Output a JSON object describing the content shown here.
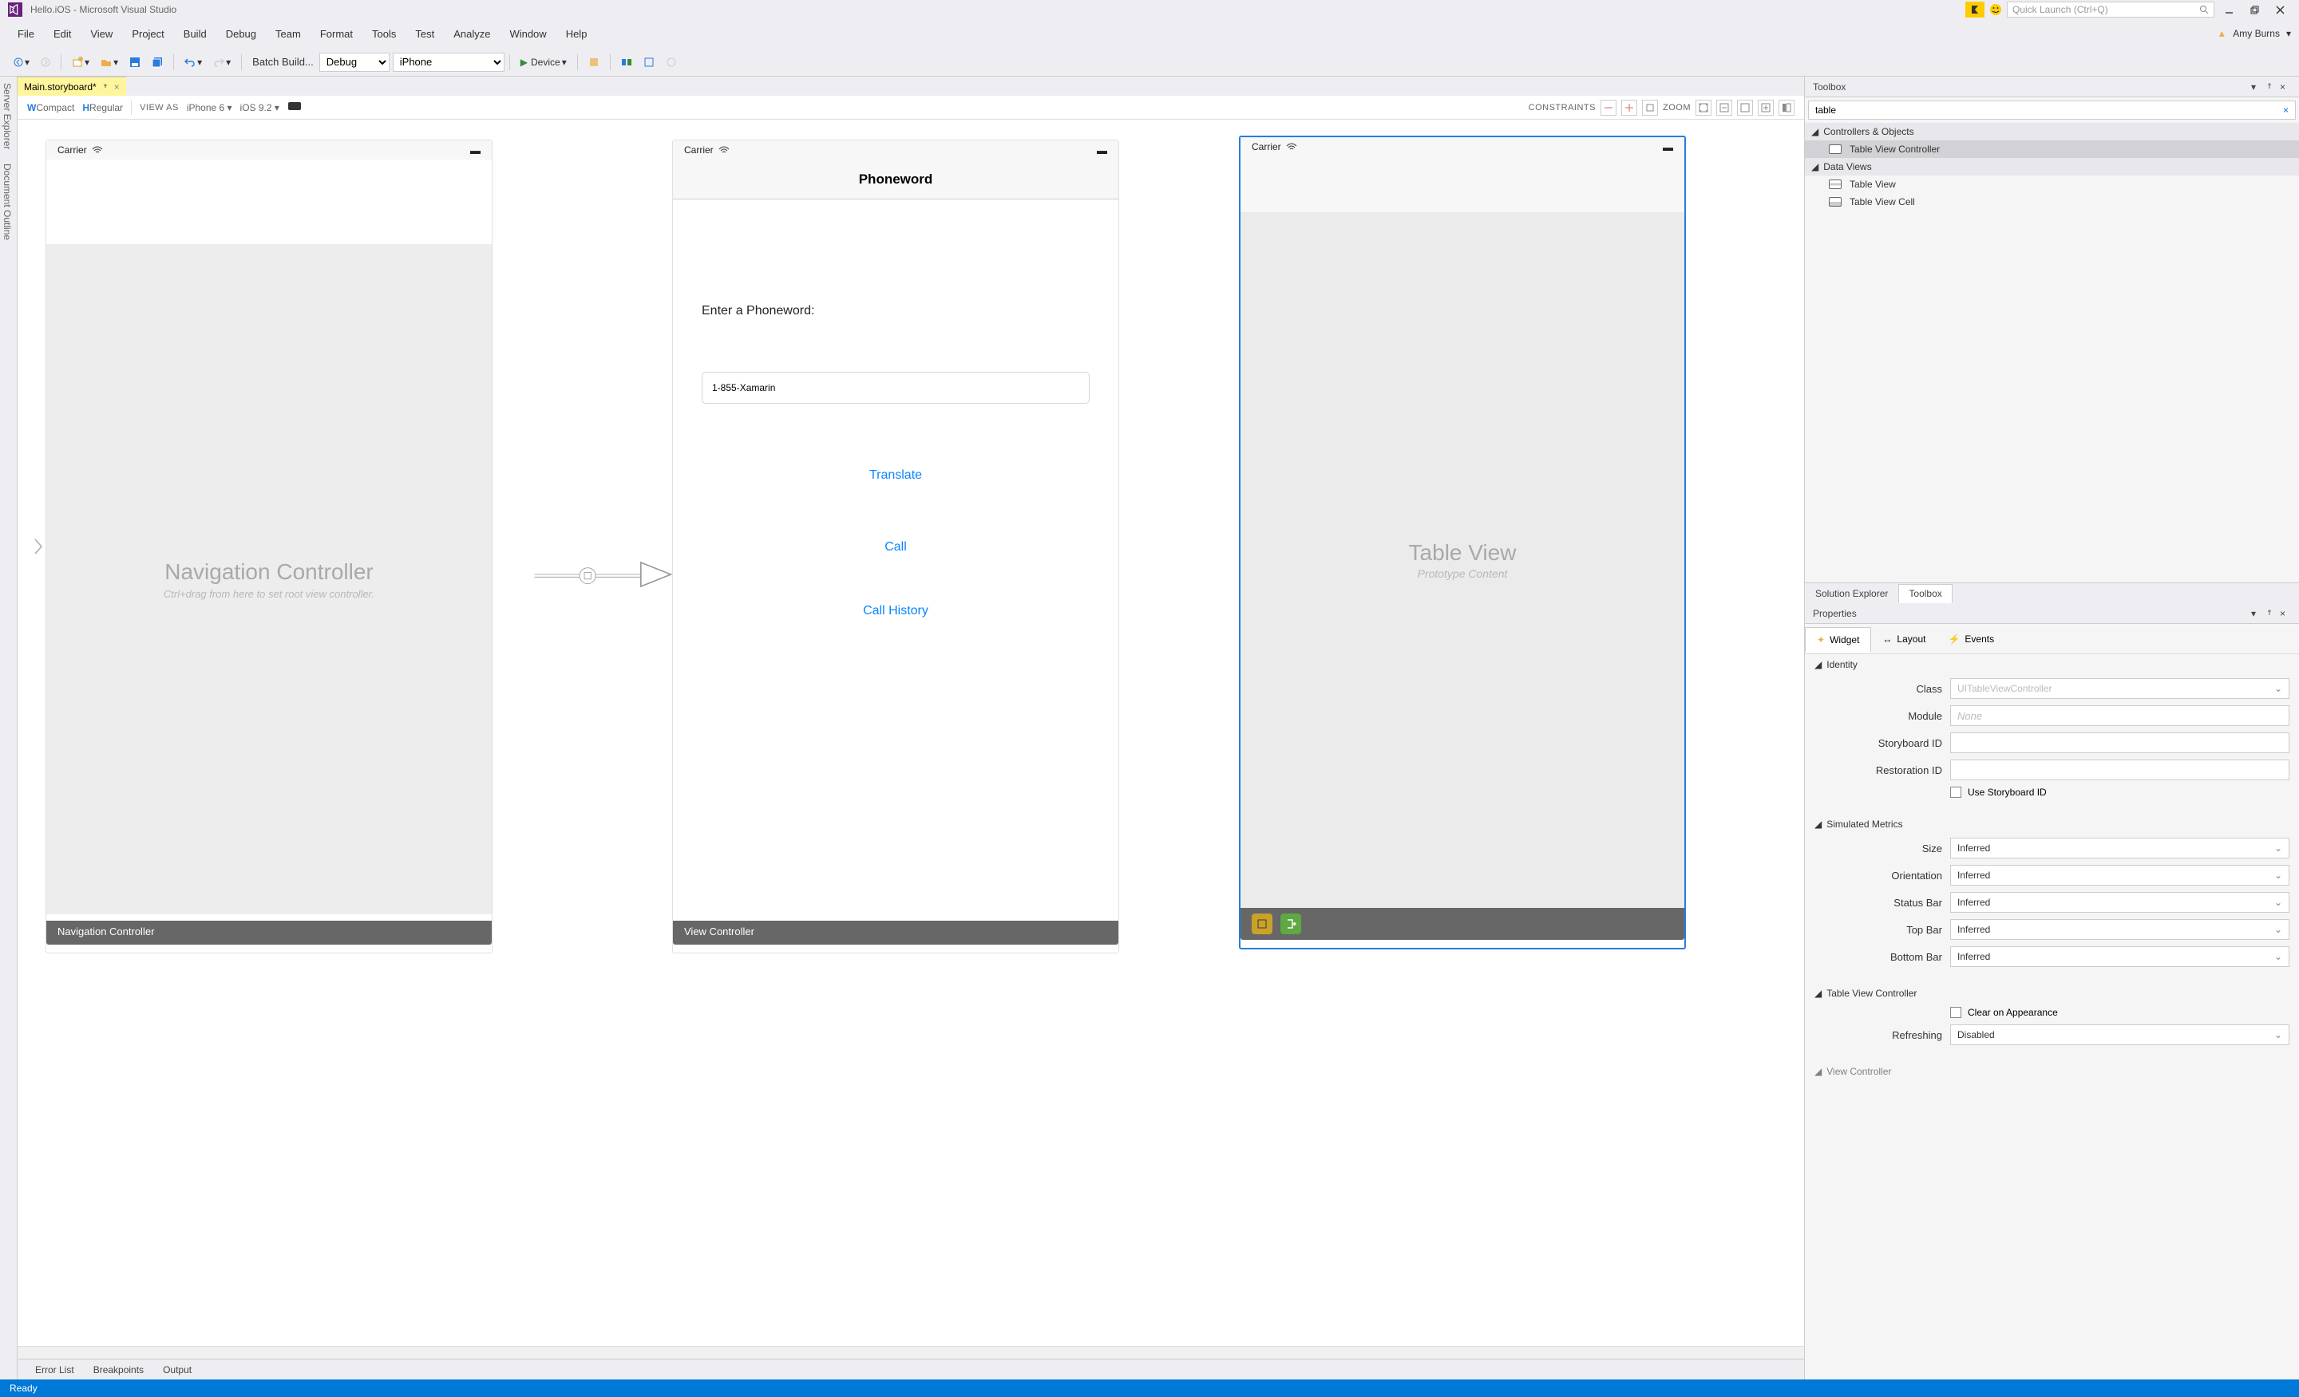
{
  "titlebar": {
    "title": "Hello.iOS - Microsoft Visual Studio",
    "quick_launch_placeholder": "Quick Launch (Ctrl+Q)"
  },
  "user": {
    "name": "Amy Burns"
  },
  "menu": [
    "File",
    "Edit",
    "View",
    "Project",
    "Build",
    "Debug",
    "Team",
    "Format",
    "Tools",
    "Test",
    "Analyze",
    "Window",
    "Help"
  ],
  "toolbar": {
    "batch_build": "Batch Build...",
    "config": "Debug",
    "platform": "iPhone",
    "device": "Device"
  },
  "doctab": {
    "name": "Main.storyboard*",
    "modified": true
  },
  "designer_bar": {
    "w": "W",
    "compact": "Compact",
    "h": "H",
    "regular": "Regular",
    "view_as": "VIEW AS",
    "device": "iPhone 6",
    "ios": "iOS 9.2",
    "constraints": "CONSTRAINTS",
    "zoom": "ZOOM"
  },
  "canvas": {
    "nav": {
      "carrier": "Carrier",
      "title": "Navigation Controller",
      "sub": "Ctrl+drag from here to set root view controller.",
      "label": "Navigation Controller"
    },
    "detail": {
      "carrier": "Carrier",
      "header": "Phoneword",
      "enter_label": "Enter a Phoneword:",
      "input": "1-855-Xamarin",
      "translate": "Translate",
      "call": "Call",
      "call_history": "Call History",
      "label": "View Controller"
    },
    "table": {
      "carrier": "Carrier",
      "title": "Table View",
      "sub": "Prototype Content"
    }
  },
  "toolbox": {
    "header": "Toolbox",
    "search": "table",
    "groups": {
      "controllers": "Controllers & Objects",
      "dataviews": "Data Views"
    },
    "items": {
      "tvc": "Table View Controller",
      "tv": "Table View",
      "tvcell": "Table View Cell"
    }
  },
  "panel_bottom_tabs": {
    "solution": "Solution Explorer",
    "toolbox": "Toolbox"
  },
  "properties": {
    "header": "Properties",
    "tabs": {
      "widget": "Widget",
      "layout": "Layout",
      "events": "Events"
    },
    "identity": {
      "section": "Identity",
      "class_label": "Class",
      "class_value": "UITableViewController",
      "module_label": "Module",
      "module_value": "None",
      "storyboard_id_label": "Storyboard ID",
      "storyboard_id": "",
      "restoration_id_label": "Restoration ID",
      "restoration_id": "",
      "use_storyboard_id": "Use Storyboard ID"
    },
    "simulated": {
      "section": "Simulated Metrics",
      "size_label": "Size",
      "size": "Inferred",
      "orientation_label": "Orientation",
      "orientation": "Inferred",
      "statusbar_label": "Status Bar",
      "statusbar": "Inferred",
      "topbar_label": "Top Bar",
      "topbar": "Inferred",
      "bottombar_label": "Bottom Bar",
      "bottombar": "Inferred"
    },
    "tvc": {
      "section": "Table View Controller",
      "clear_on_appearance": "Clear on Appearance",
      "refreshing_label": "Refreshing",
      "refreshing": "Disabled"
    },
    "vc": {
      "section": "View Controller"
    }
  },
  "bottom_tabs": [
    "Error List",
    "Breakpoints",
    "Output"
  ],
  "status": "Ready",
  "side_tabs": [
    "Server Explorer",
    "Document Outline"
  ]
}
